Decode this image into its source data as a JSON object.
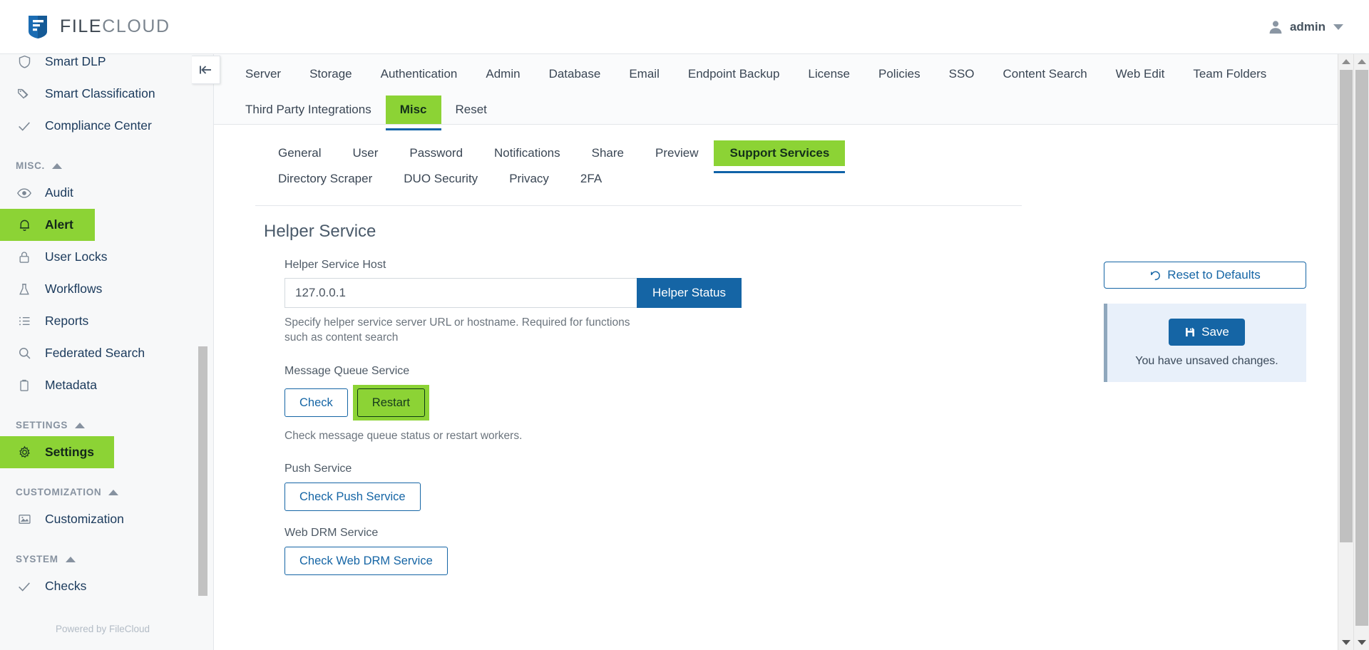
{
  "header": {
    "brand_file": "FILE",
    "brand_cloud": "CLOUD",
    "user_name": "admin",
    "user_icon": "user-avatar-icon",
    "caret_icon": "chevron-down-icon"
  },
  "sidebar": {
    "items_top": [
      {
        "label": "Smart DLP",
        "icon": "shield-icon",
        "active": false
      },
      {
        "label": "Smart Classification",
        "icon": "tag-icon",
        "active": false
      },
      {
        "label": "Compliance Center",
        "icon": "check-icon",
        "active": false
      }
    ],
    "group_misc": "MISC.",
    "items_misc": [
      {
        "label": "Audit",
        "icon": "eye-icon",
        "active": false
      },
      {
        "label": "Alert",
        "icon": "bell-icon",
        "active": true
      },
      {
        "label": "User Locks",
        "icon": "lock-icon",
        "active": false
      },
      {
        "label": "Workflows",
        "icon": "flask-icon",
        "active": false
      },
      {
        "label": "Reports",
        "icon": "list-icon",
        "active": false
      },
      {
        "label": "Federated Search",
        "icon": "search-icon",
        "active": false
      },
      {
        "label": "Metadata",
        "icon": "clipboard-icon",
        "active": false
      }
    ],
    "group_settings": "SETTINGS",
    "items_settings": [
      {
        "label": "Settings",
        "icon": "gear-icon",
        "active": true
      }
    ],
    "group_customization": "CUSTOMIZATION",
    "items_customization": [
      {
        "label": "Customization",
        "icon": "image-icon",
        "active": false
      }
    ],
    "group_system": "SYSTEM",
    "items_system": [
      {
        "label": "Checks",
        "icon": "check-icon",
        "active": false
      }
    ],
    "footer": "Powered by FileCloud",
    "collapse_icon": "collapse-sidebar-icon"
  },
  "nav": {
    "row1": [
      {
        "label": "Server",
        "active": false
      },
      {
        "label": "Storage",
        "active": false
      },
      {
        "label": "Authentication",
        "active": false
      },
      {
        "label": "Admin",
        "active": false
      },
      {
        "label": "Database",
        "active": false
      },
      {
        "label": "Email",
        "active": false
      },
      {
        "label": "Endpoint Backup",
        "active": false
      },
      {
        "label": "License",
        "active": false
      },
      {
        "label": "Policies",
        "active": false
      },
      {
        "label": "SSO",
        "active": false
      },
      {
        "label": "Content Search",
        "active": false
      },
      {
        "label": "Web Edit",
        "active": false
      },
      {
        "label": "Team Folders",
        "active": false
      }
    ],
    "row2": [
      {
        "label": "Third Party Integrations",
        "active": false
      },
      {
        "label": "Misc",
        "active": true
      },
      {
        "label": "Reset",
        "active": false
      }
    ]
  },
  "subtabs": [
    {
      "label": "General",
      "active": false
    },
    {
      "label": "User",
      "active": false
    },
    {
      "label": "Password",
      "active": false
    },
    {
      "label": "Notifications",
      "active": false
    },
    {
      "label": "Share",
      "active": false
    },
    {
      "label": "Preview",
      "active": false
    },
    {
      "label": "Support Services",
      "active": true
    },
    {
      "label": "Directory Scraper",
      "active": false
    },
    {
      "label": "DUO Security",
      "active": false
    },
    {
      "label": "Privacy",
      "active": false
    },
    {
      "label": "2FA",
      "active": false
    }
  ],
  "main": {
    "section_title": "Helper Service",
    "helper_host_label": "Helper Service Host",
    "helper_host_value": "127.0.0.1",
    "helper_status_button": "Helper Status",
    "helper_help": "Specify helper service server URL or hostname. Required for functions such as content search",
    "mq_label": "Message Queue Service",
    "mq_check_button": "Check",
    "mq_restart_button": "Restart",
    "mq_help": "Check message queue status or restart workers.",
    "push_label": "Push Service",
    "push_button": "Check Push Service",
    "drm_label": "Web DRM Service",
    "drm_button": "Check Web DRM Service"
  },
  "right_panel": {
    "reset_button": "Reset to Defaults",
    "reset_icon": "undo-icon",
    "save_button": "Save",
    "save_icon": "floppy-disk-icon",
    "unsaved_note": "You have unsaved changes."
  },
  "colors": {
    "accent_green": "#8cd335",
    "accent_blue": "#1565a5",
    "underline_blue": "#0f63a8",
    "sidebar_bg": "#f7f8f9",
    "save_card_bg": "#e8f0fa"
  }
}
